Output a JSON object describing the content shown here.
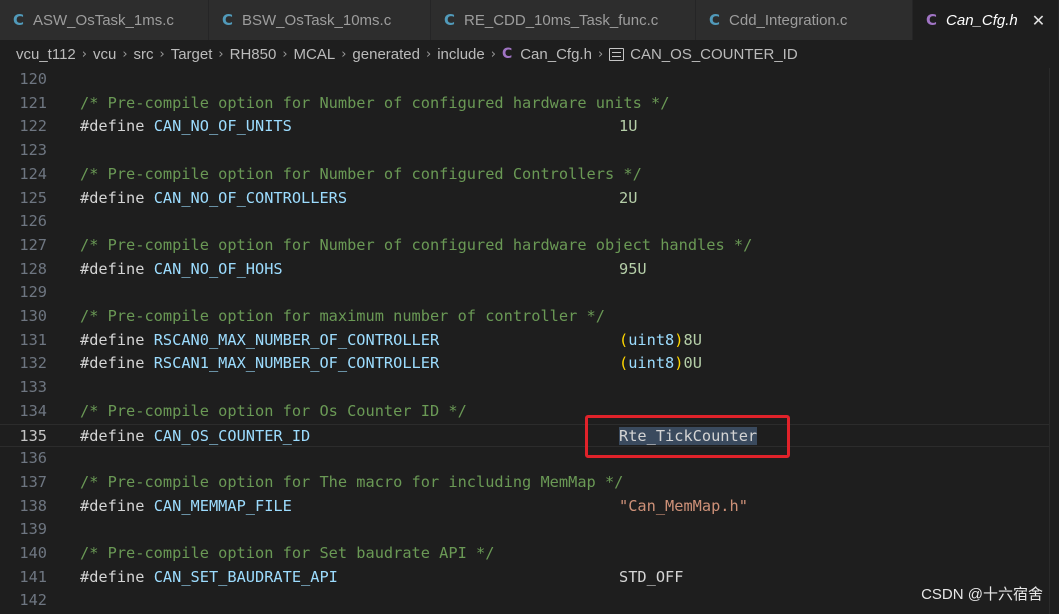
{
  "tabs": [
    {
      "label": "ASW_OsTask_1ms.c",
      "icon": "c-file-icon",
      "active": false
    },
    {
      "label": "BSW_OsTask_10ms.c",
      "icon": "c-file-icon",
      "active": false
    },
    {
      "label": "RE_CDD_10ms_Task_func.c",
      "icon": "c-file-icon",
      "active": false
    },
    {
      "label": "Cdd_Integration.c",
      "icon": "c-file-icon",
      "active": false
    },
    {
      "label": "Can_Cfg.h",
      "icon": "h-file-icon",
      "active": true
    }
  ],
  "tab_icon_glyph": "C",
  "close_glyph": "✕",
  "breadcrumb": {
    "parts": [
      "vcu_t112",
      "vcu",
      "src",
      "Target",
      "RH850",
      "MCAL",
      "generated",
      "include"
    ],
    "file": "Can_Cfg.h",
    "symbol": "CAN_OS_COUNTER_ID"
  },
  "editor": {
    "lines": [
      {
        "n": "120",
        "type": "blank"
      },
      {
        "n": "121",
        "type": "comment",
        "text": "/* Pre-compile option for Number of configured hardware units */"
      },
      {
        "n": "122",
        "type": "define",
        "name": "CAN_NO_OF_UNITS",
        "value": "1U",
        "vtype": "num"
      },
      {
        "n": "123",
        "type": "blank"
      },
      {
        "n": "124",
        "type": "comment",
        "text": "/* Pre-compile option for Number of configured Controllers */"
      },
      {
        "n": "125",
        "type": "define",
        "name": "CAN_NO_OF_CONTROLLERS",
        "value": "2U",
        "vtype": "num"
      },
      {
        "n": "126",
        "type": "blank"
      },
      {
        "n": "127",
        "type": "comment",
        "text": "/* Pre-compile option for Number of configured hardware object handles */"
      },
      {
        "n": "128",
        "type": "define",
        "name": "CAN_NO_OF_HOHS",
        "value": "95U",
        "vtype": "num"
      },
      {
        "n": "129",
        "type": "blank"
      },
      {
        "n": "130",
        "type": "comment",
        "text": "/* Pre-compile option for maximum number of controller */"
      },
      {
        "n": "131",
        "type": "define",
        "name": "RSCAN0_MAX_NUMBER_OF_CONTROLLER",
        "cast": "uint8",
        "value": "8U",
        "vtype": "cast"
      },
      {
        "n": "132",
        "type": "define",
        "name": "RSCAN1_MAX_NUMBER_OF_CONTROLLER",
        "cast": "uint8",
        "value": "0U",
        "vtype": "cast"
      },
      {
        "n": "133",
        "type": "blank"
      },
      {
        "n": "134",
        "type": "comment",
        "text": "/* Pre-compile option for Os Counter ID */"
      },
      {
        "n": "135",
        "type": "define",
        "name": "CAN_OS_COUNTER_ID",
        "value": "Rte_TickCounter",
        "vtype": "ident",
        "current": true
      },
      {
        "n": "136",
        "type": "blank"
      },
      {
        "n": "137",
        "type": "comment",
        "text": "/* Pre-compile option for The macro for including MemMap */"
      },
      {
        "n": "138",
        "type": "define",
        "name": "CAN_MEMMAP_FILE",
        "value": "\"Can_MemMap.h\"",
        "vtype": "str"
      },
      {
        "n": "139",
        "type": "blank"
      },
      {
        "n": "140",
        "type": "comment",
        "text": "/* Pre-compile option for Set baudrate API */"
      },
      {
        "n": "141",
        "type": "define",
        "name": "CAN_SET_BAUDRATE_API",
        "value": "STD_OFF",
        "vtype": "ident"
      },
      {
        "n": "142",
        "type": "blank"
      }
    ],
    "define_keyword": "#define"
  },
  "colors": {
    "highlight_box": "#e0222a",
    "comment": "#6a9955",
    "macro": "#9cdcfe"
  },
  "watermark": "CSDN @十六宿舍"
}
